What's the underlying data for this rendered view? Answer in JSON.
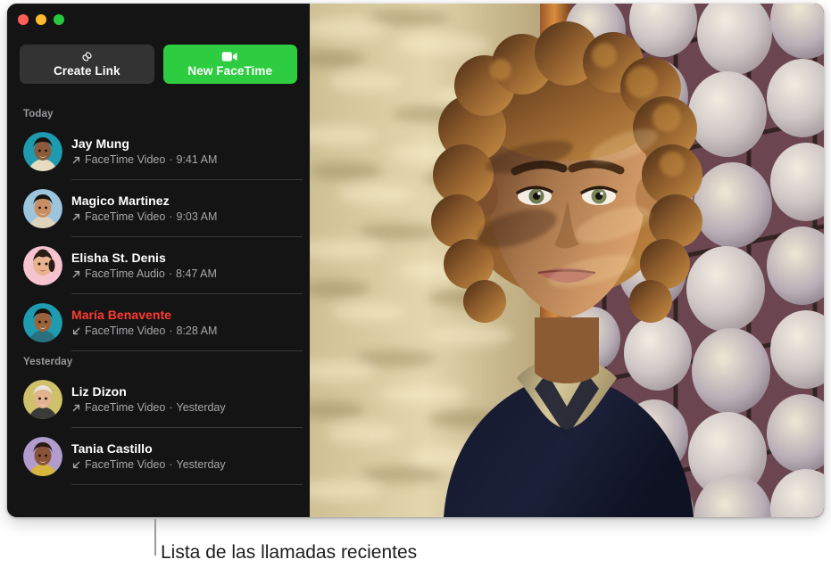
{
  "window": {
    "traffic_lights": [
      {
        "name": "close",
        "color": "#ff5f57"
      },
      {
        "name": "minimize",
        "color": "#febc2e"
      },
      {
        "name": "zoom",
        "color": "#28c840"
      }
    ]
  },
  "toolbar": {
    "create_link": {
      "label": "Create Link",
      "icon": "link-icon",
      "bg": "#333333"
    },
    "new_facetime": {
      "label": "New FaceTime",
      "icon": "video-camera-icon",
      "bg": "#2ecc41"
    }
  },
  "sections": [
    {
      "header": "Today",
      "calls": [
        {
          "name": "Jay Mung",
          "type": "FaceTime Video",
          "time": "9:41 AM",
          "separator": " · ",
          "direction": "outgoing",
          "missed": false,
          "avatar": {
            "style": "photo",
            "bg": "#1f9bb0",
            "skin": "#8a5a3b",
            "hair": "#1a120d",
            "shirt": "#e8dcc0"
          }
        },
        {
          "name": "Magico Martinez",
          "type": "FaceTime Video",
          "time": "9:03 AM",
          "separator": " · ",
          "direction": "outgoing",
          "missed": false,
          "avatar": {
            "style": "photo",
            "bg": "#9dc4dd",
            "skin": "#c98f62",
            "hair": "#161210",
            "shirt": "#dfd3bb"
          }
        },
        {
          "name": "Elisha St. Denis",
          "type": "FaceTime Audio",
          "time": "8:47 AM",
          "separator": " · ",
          "direction": "outgoing",
          "missed": false,
          "avatar": {
            "style": "memoji",
            "bg": "#f6c3d0",
            "skin": "#e8b48e",
            "hair": "#2a1b15",
            "shirt": "#f6c3d0"
          }
        },
        {
          "name": "María Benavente",
          "type": "FaceTime Video",
          "time": "8:28 AM",
          "separator": " · ",
          "direction": "incoming",
          "missed": true,
          "avatar": {
            "style": "photo",
            "bg": "#1f9bb0",
            "skin": "#9c6239",
            "hair": "#17100c",
            "shirt": "#2a6f7e"
          }
        }
      ]
    },
    {
      "header": "Yesterday",
      "calls": [
        {
          "name": "Liz Dizon",
          "type": "FaceTime Video",
          "time": "Yesterday",
          "separator": " · ",
          "direction": "outgoing",
          "missed": false,
          "avatar": {
            "style": "photo",
            "bg": "#cfc06a",
            "skin": "#e2b291",
            "hair": "#e8e4da",
            "shirt": "#3a3a38"
          }
        },
        {
          "name": "Tania Castillo",
          "type": "FaceTime Video",
          "time": "Yesterday",
          "separator": " · ",
          "direction": "incoming",
          "missed": false,
          "avatar": {
            "style": "photo",
            "bg": "#b09ccd",
            "skin": "#8a5336",
            "hair": "#2b1b12",
            "shirt": "#d8b63e"
          }
        }
      ]
    }
  ],
  "video": {
    "description": "facetime-video-preview",
    "backdrop_left": "#d8c89a",
    "backdrop_right": "#6e4a52"
  },
  "callout": {
    "label": "Lista de las llamadas recientes"
  }
}
